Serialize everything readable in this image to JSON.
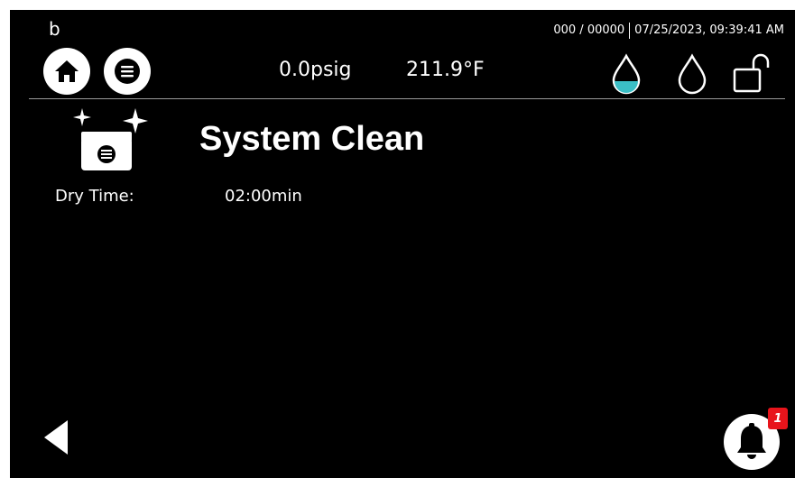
{
  "header": {
    "logo_letter": "b",
    "counter": "000 / 00000",
    "datetime": "07/25/2023, 09:39:41 AM",
    "pressure": "0.0psig",
    "temperature": "211.9°F",
    "icons": [
      "home-icon",
      "menu-icon",
      "water-drop-partial-icon",
      "water-drop-empty-icon",
      "unlocked-icon"
    ]
  },
  "main": {
    "title": "System Clean",
    "icon": "sparkling-clean-tray-icon",
    "dry_time_label": "Dry Time:",
    "dry_time_value": "02:00min"
  },
  "footer": {
    "back_icon": "back-arrow-icon",
    "notification_icon": "bell-icon",
    "notification_count": "1"
  },
  "colors": {
    "background": "#000000",
    "water_level": "#3bbfc6",
    "badge": "#e8141b"
  }
}
